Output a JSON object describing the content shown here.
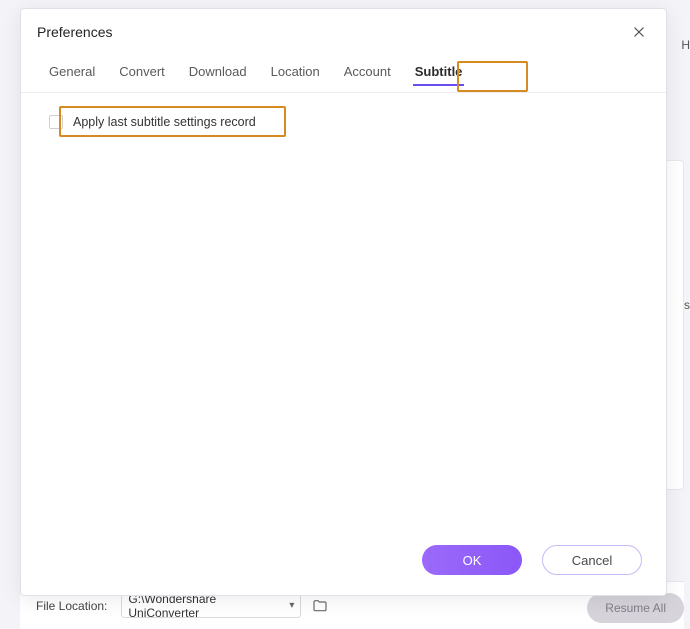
{
  "bg": {
    "file_location_label": "File Location:",
    "file_location_value": "G:\\Wondershare UniConverter ",
    "resume_all": "Resume All",
    "h_fragment": "H",
    "s_fragment": "s"
  },
  "dialog": {
    "title": "Preferences",
    "tabs": {
      "general": "General",
      "convert": "Convert",
      "download": "Download",
      "location": "Location",
      "account": "Account",
      "subtitle": "Subtitle"
    },
    "option": {
      "apply_last_label": "Apply last subtitle settings record"
    },
    "buttons": {
      "ok": "OK",
      "cancel": "Cancel"
    }
  }
}
